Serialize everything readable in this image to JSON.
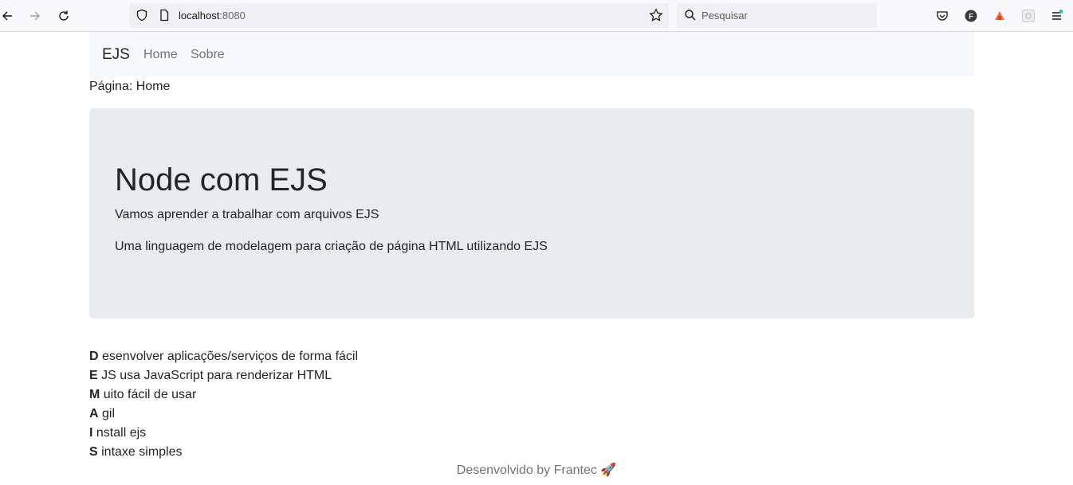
{
  "browser": {
    "url_host": "localhost",
    "url_port": ":8080",
    "search_placeholder": "Pesquisar"
  },
  "navbar": {
    "brand": "EJS",
    "links": [
      "Home",
      "Sobre"
    ]
  },
  "page_label": "Página: Home",
  "jumbotron": {
    "title": "Node com EJS",
    "lead": "Vamos aprender a trabalhar com arquivos EJS",
    "text": "Uma linguagem de modelagem para criação de página HTML utilizando EJS"
  },
  "acronym": [
    {
      "letter": "D",
      "rest": " esenvolver aplicações/serviços de forma fácil"
    },
    {
      "letter": "E",
      "rest": " JS usa JavaScript para renderizar HTML"
    },
    {
      "letter": "M",
      "rest": " uito fácil de usar"
    },
    {
      "letter": "A",
      "rest": " gil"
    },
    {
      "letter": "I",
      "rest": " nstall ejs"
    },
    {
      "letter": "S",
      "rest": " intaxe simples"
    }
  ],
  "footer": "Desenvolvido by Frantec 🚀"
}
